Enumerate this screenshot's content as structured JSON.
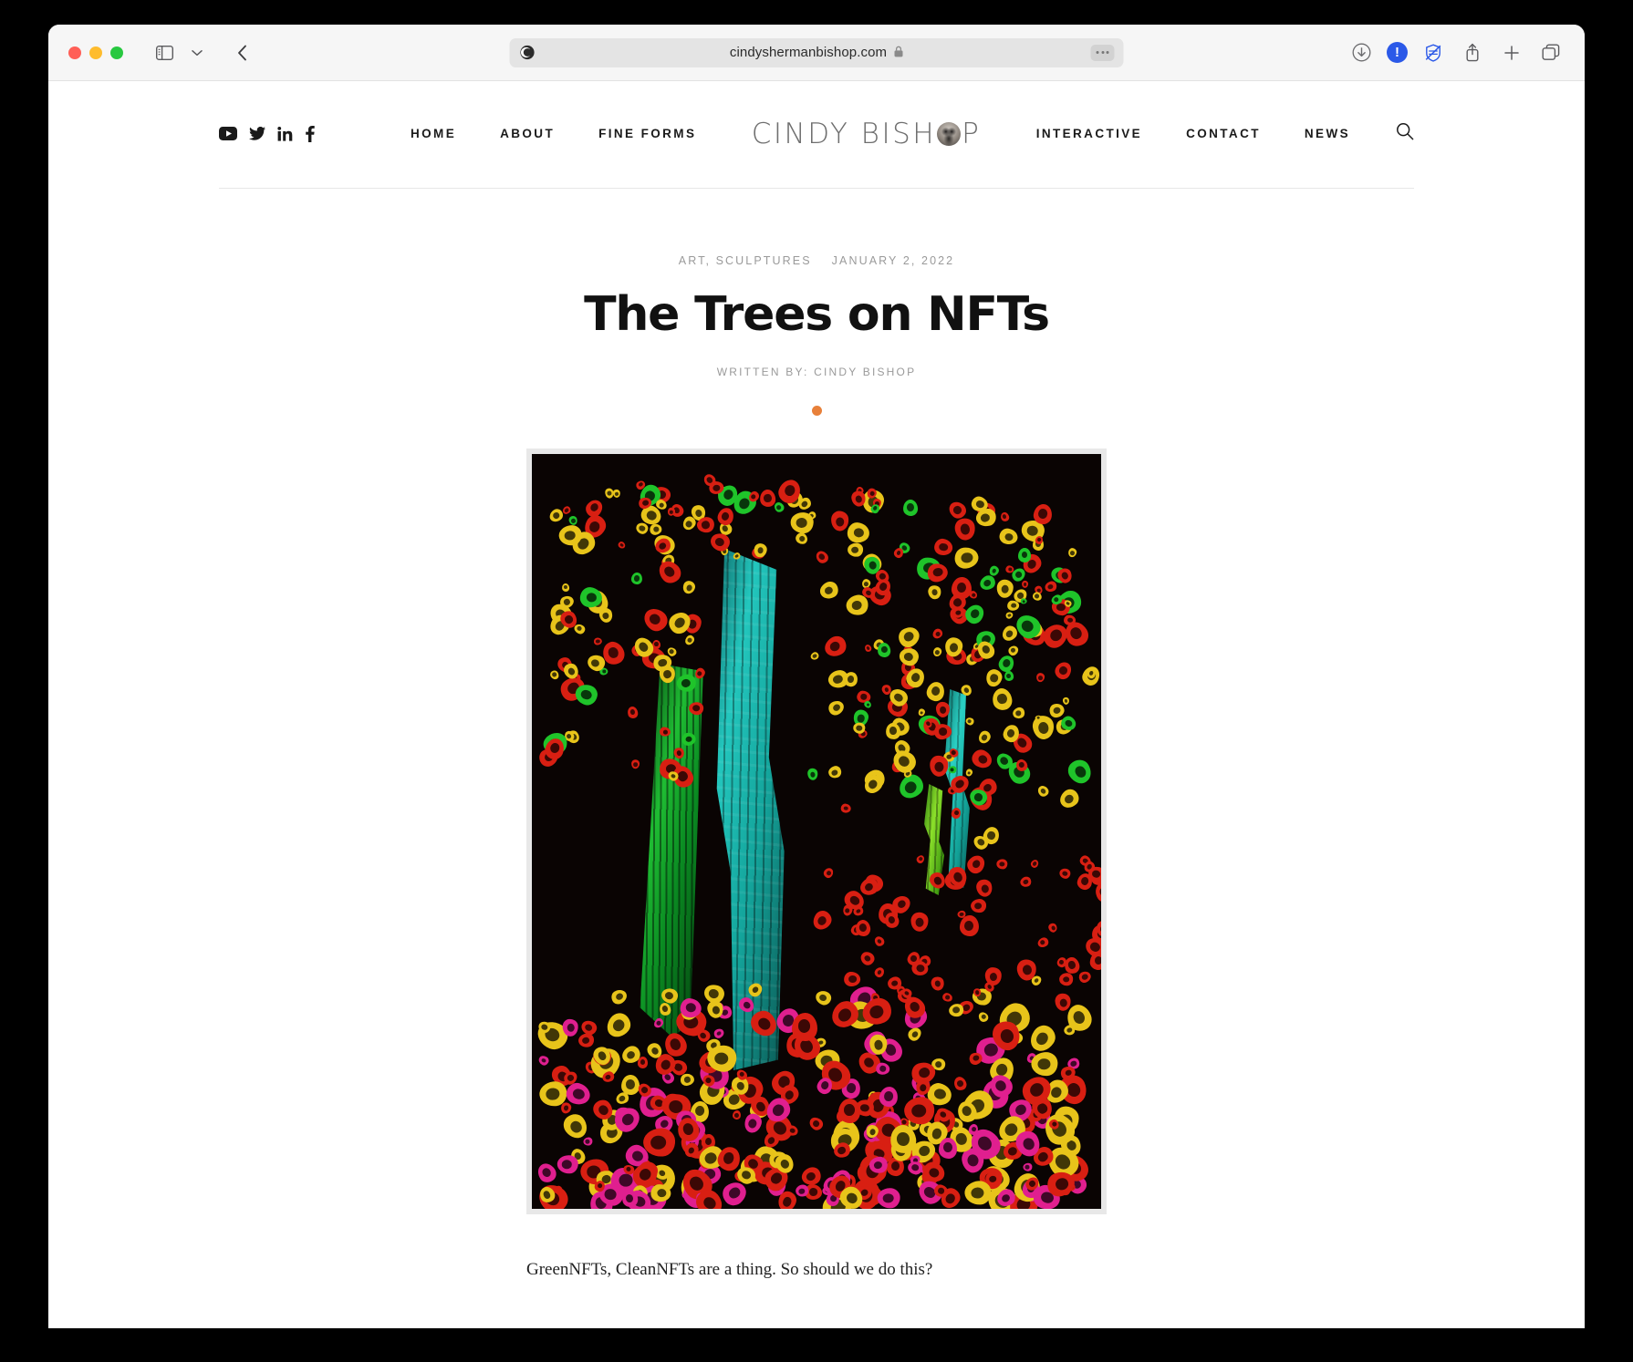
{
  "browser": {
    "url": "cindyshermanbishop.com",
    "lock_glyph": "🔒",
    "icons": {
      "sidebar": "sidebar-icon",
      "sidebar_chevron": "chevron-down-icon",
      "back": "back-arrow-icon",
      "reader": "reader-mode-icon",
      "more": "more-options-icon",
      "download": "download-icon",
      "alert": "alert-badge-icon",
      "privacy": "privacy-report-icon",
      "share": "share-icon",
      "new_tab": "plus-icon",
      "tab_overview": "tab-overview-icon"
    },
    "alert_badge_label": "!",
    "alert_badge_color": "#2b59e8"
  },
  "site": {
    "logo_before": "CINDY BISH",
    "logo_after": "P",
    "socials": [
      {
        "name": "youtube",
        "label": "YouTube"
      },
      {
        "name": "twitter",
        "label": "Twitter"
      },
      {
        "name": "linkedin",
        "label": "LinkedIn"
      },
      {
        "name": "facebook",
        "label": "Facebook"
      }
    ],
    "nav_left": [
      {
        "label": "HOME"
      },
      {
        "label": "ABOUT"
      },
      {
        "label": "FINE FORMS"
      }
    ],
    "nav_right": [
      {
        "label": "INTERACTIVE"
      },
      {
        "label": "CONTACT"
      },
      {
        "label": "NEWS"
      }
    ],
    "search_label": "Search"
  },
  "article": {
    "categories": "ART, SCULPTURES",
    "date": "JANUARY 2, 2022",
    "title": "The Trees on NFTs",
    "byline": "WRITTEN BY: CINDY BISHOP",
    "divider_color": "#e8803a",
    "artwork_alt": "Digital sculpture of three glowing trees on a black background with red, green, yellow and magenta eye-shaped leaves",
    "paragraphs": [
      "GreenNFTs, CleanNFTs are a thing. So should we do this?"
    ]
  }
}
